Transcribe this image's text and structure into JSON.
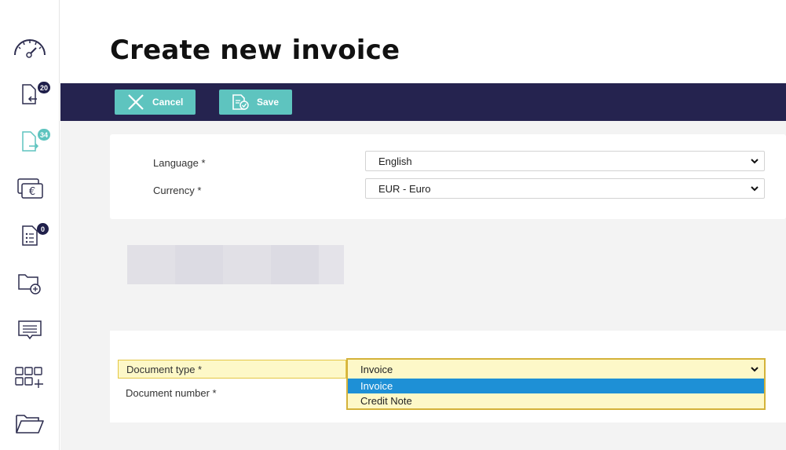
{
  "page": {
    "title": "Create new invoice"
  },
  "sidebar": {
    "items": [
      {
        "name": "dashboard"
      },
      {
        "name": "incoming-documents",
        "badge": "20"
      },
      {
        "name": "outgoing-documents",
        "badge": "34"
      },
      {
        "name": "payments"
      },
      {
        "name": "tasks",
        "badge": "0"
      },
      {
        "name": "add-folder"
      },
      {
        "name": "messages"
      },
      {
        "name": "apps"
      },
      {
        "name": "folders"
      }
    ]
  },
  "toolbar": {
    "cancel_label": "Cancel",
    "save_label": "Save"
  },
  "form": {
    "language": {
      "label": "Language *",
      "value": "English"
    },
    "currency": {
      "label": "Currency *",
      "value": "EUR - Euro"
    },
    "document_type": {
      "label": "Document type *",
      "value": "Invoice",
      "options": [
        "Invoice",
        "Credit Note"
      ]
    },
    "document_number": {
      "label": "Document number *"
    }
  },
  "colors": {
    "toolbar_bg": "#25234f",
    "button_bg": "#5ec4bf",
    "highlight_bg": "#fdf8c8",
    "highlight_border": "#d4b23a",
    "option_selected": "#1e90d6"
  }
}
